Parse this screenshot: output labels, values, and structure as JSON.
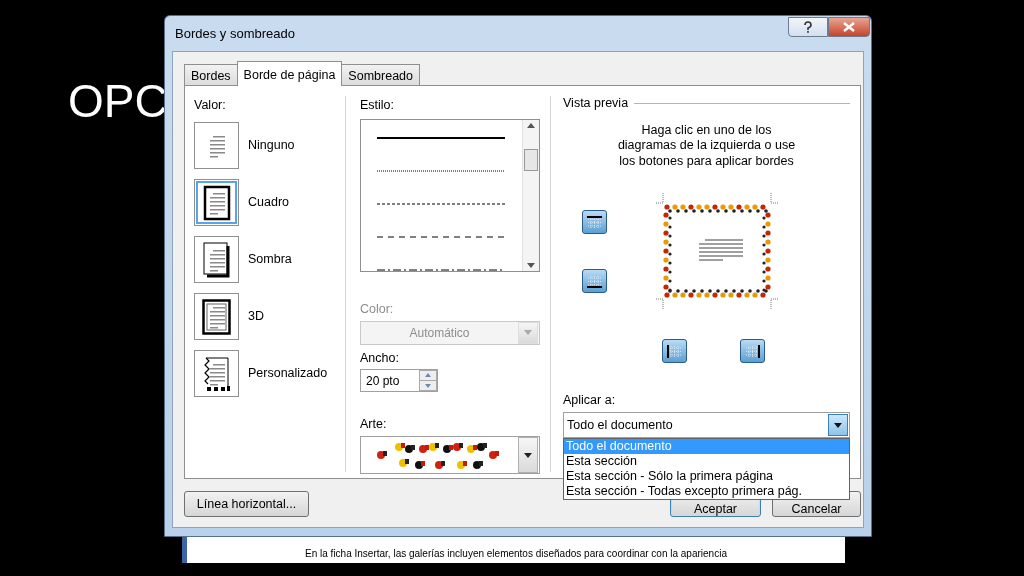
{
  "slide_title": "OPC",
  "window": {
    "title": "Bordes y sombreado"
  },
  "tabs": [
    {
      "label": "Bordes",
      "selected": false
    },
    {
      "label": "Borde de página",
      "selected": true
    },
    {
      "label": "Sombreado",
      "selected": false
    }
  ],
  "valor": {
    "label": "Valor:",
    "items": [
      {
        "label": "Ninguno",
        "kind": "none",
        "selected": false
      },
      {
        "label": "Cuadro",
        "kind": "box",
        "selected": true
      },
      {
        "label": "Sombra",
        "kind": "shadow",
        "selected": false
      },
      {
        "label": "3D",
        "kind": "threed",
        "selected": false
      },
      {
        "label": "Personalizado",
        "kind": "custom",
        "selected": false
      }
    ]
  },
  "estilo": {
    "label": "Estilo:",
    "styles": [
      {
        "kind": "solid"
      },
      {
        "kind": "dotted"
      },
      {
        "kind": "fine-dashed"
      },
      {
        "kind": "dashed"
      },
      {
        "kind": "dash-dot"
      }
    ]
  },
  "color": {
    "label": "Color:",
    "value": "Automático",
    "disabled": true
  },
  "ancho": {
    "label": "Ancho:",
    "value": "20 pto"
  },
  "arte": {
    "label": "Arte:"
  },
  "preview": {
    "title": "Vista previa",
    "instructions": "Haga clic en uno de los\ndiagramas de la izquierda o use\nlos botones para aplicar bordes",
    "border_buttons": [
      {
        "kind": "top"
      },
      {
        "kind": "bottom"
      },
      {
        "kind": "left"
      },
      {
        "kind": "right"
      }
    ]
  },
  "apply_to": {
    "label": "Aplicar a:",
    "value": "Todo el documento",
    "expanded": true,
    "options": [
      {
        "label": "Todo el documento",
        "selected": true
      },
      {
        "label": "Esta sección",
        "selected": false
      },
      {
        "label": "Esta sección - Sólo la primera página",
        "selected": false
      },
      {
        "label": "Esta sección - Todas excepto primera pág.",
        "selected": false
      }
    ]
  },
  "buttons": [
    {
      "label": "Línea horizontal...",
      "default": false
    },
    {
      "label": "Aceptar",
      "default": true
    },
    {
      "label": "Cancelar",
      "default": false
    }
  ],
  "document_text": "En la ficha Insertar, las galerías incluyen elementos diseñados para coordinar con la apariencia"
}
